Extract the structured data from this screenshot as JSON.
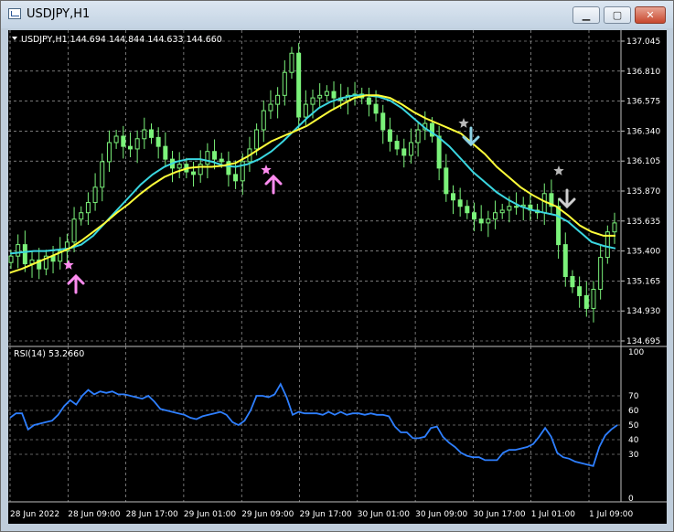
{
  "window": {
    "title": "USDJPY,H1",
    "minimize_glyph": "▁",
    "maximize_glyph": "▢",
    "close_glyph": "✕"
  },
  "header": {
    "info_text": "USDJPY,H1  144.694 144.844 144.633 144.660"
  },
  "rsi_panel": {
    "label": "RSI(14) 53.2660"
  },
  "colors": {
    "background": "#000000",
    "grid": "#bfbfbf",
    "bull_candle": "#7bf27a",
    "axis_text": "#ffffff",
    "ma_fast": "#3ad6e0",
    "ma_slow": "#ffff3a",
    "rsi_line": "#2e7fff",
    "buy_arrow": "#ff8cf0",
    "sell_arrow": "#cfcfcf",
    "star": "#b9b9b9"
  },
  "chart_data": [
    {
      "type": "line",
      "symbol": "USDJPY",
      "timeframe": "H1",
      "y_ticks": [
        137.045,
        136.81,
        136.575,
        136.34,
        136.105,
        135.87,
        135.635,
        135.4,
        135.165,
        134.93,
        134.695
      ],
      "x_ticks": [
        "28 Jun 2022",
        "28 Jun 09:00",
        "28 Jun 17:00",
        "29 Jun 01:00",
        "29 Jun 09:00",
        "29 Jun 17:00",
        "30 Jun 01:00",
        "30 Jun 09:00",
        "30 Jun 17:00",
        "1 Jul 01:00",
        "1 Jul 09:00"
      ],
      "ylim": [
        134.695,
        137.045
      ],
      "grid": true,
      "close_series": [
        135.36,
        135.45,
        135.3,
        135.33,
        135.26,
        135.36,
        135.32,
        135.4,
        135.47,
        135.65,
        135.7,
        135.78,
        135.9,
        136.1,
        136.25,
        136.3,
        136.22,
        136.2,
        136.28,
        136.35,
        136.29,
        136.22,
        136.12,
        136.05,
        136.08,
        136.02,
        136.0,
        136.08,
        136.18,
        136.12,
        136.1,
        136.0,
        135.95,
        136.1,
        136.2,
        136.35,
        136.5,
        136.55,
        136.62,
        136.8,
        136.95,
        136.45,
        136.55,
        136.6,
        136.62,
        136.65,
        136.6,
        136.58,
        136.62,
        136.63,
        136.6,
        136.55,
        136.48,
        136.35,
        136.26,
        136.2,
        136.15,
        136.25,
        136.35,
        136.4,
        136.3,
        136.05,
        135.85,
        135.8,
        135.75,
        135.7,
        135.65,
        135.62,
        135.65,
        135.7,
        135.72,
        135.75,
        135.75,
        135.76,
        135.72,
        135.7,
        135.85,
        135.75,
        135.45,
        135.2,
        135.12,
        135.05,
        134.95,
        135.1,
        135.35,
        135.55,
        135.62
      ],
      "series": [
        {
          "name": "",
          "values": [
            135.38,
            135.39,
            135.4,
            135.4,
            135.41,
            135.42,
            135.45,
            135.52,
            135.62,
            135.72,
            135.82,
            135.92,
            136.0,
            136.06,
            136.1,
            136.12,
            136.12,
            136.1,
            136.07,
            136.06,
            136.08,
            136.12,
            136.18,
            136.26,
            136.35,
            136.44,
            136.52,
            136.57,
            136.6,
            136.62,
            136.62,
            136.61,
            136.58,
            136.52,
            136.44,
            136.36,
            136.3,
            136.22,
            136.12,
            136.02,
            135.94,
            135.86,
            135.8,
            135.75,
            135.72,
            135.7,
            135.68,
            135.63,
            135.55,
            135.47,
            135.44,
            135.42
          ]
        },
        {
          "name": "",
          "values": [
            135.23,
            135.26,
            135.3,
            135.34,
            135.38,
            135.42,
            135.48,
            135.55,
            135.62,
            135.7,
            135.77,
            135.85,
            135.92,
            135.98,
            136.02,
            136.05,
            136.06,
            136.06,
            136.07,
            136.09,
            136.14,
            136.2,
            136.26,
            136.3,
            136.34,
            136.38,
            136.44,
            136.5,
            136.55,
            136.6,
            136.62,
            136.62,
            136.6,
            136.55,
            136.49,
            136.44,
            136.4,
            136.36,
            136.32,
            136.24,
            136.16,
            136.06,
            135.98,
            135.9,
            135.84,
            135.79,
            135.75,
            135.68,
            135.6,
            135.55,
            135.52,
            135.52
          ]
        }
      ]
    },
    {
      "type": "line",
      "title": "RSI(14) 53.2660",
      "ylim": [
        0,
        100
      ],
      "y_ticks": [
        100,
        70,
        60,
        50,
        40,
        30,
        0
      ],
      "series": [
        {
          "name": "",
          "values": [
            55,
            58,
            58,
            47,
            50,
            51,
            52,
            53,
            57,
            63,
            67,
            64,
            70,
            74,
            71,
            73,
            72,
            73,
            71,
            71,
            70,
            69,
            68,
            70,
            66,
            61,
            60,
            59,
            58,
            57,
            55,
            54,
            56,
            57,
            58,
            59,
            57,
            52,
            50,
            53,
            60,
            70,
            70,
            69,
            71,
            78,
            69,
            57,
            59,
            58,
            58,
            58,
            57,
            59,
            57,
            59,
            57,
            58,
            58,
            57,
            58,
            57,
            57,
            56,
            49,
            45,
            45,
            41,
            41,
            42,
            48,
            49,
            42,
            38,
            35,
            31,
            29,
            28,
            28,
            26,
            26,
            26,
            31,
            33,
            33,
            34,
            35,
            37,
            42,
            48,
            42,
            31,
            28,
            27,
            25,
            24,
            23,
            22,
            35,
            43,
            47,
            50
          ]
        }
      ]
    }
  ]
}
